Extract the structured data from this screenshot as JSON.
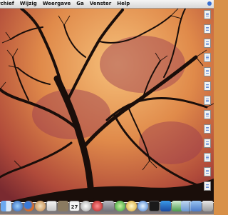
{
  "menubar": {
    "items": [
      "rchief",
      "Wijzig",
      "Weergave",
      "Ga",
      "Venster",
      "Help"
    ]
  },
  "dock": {
    "calendar_date": "27",
    "icons": [
      "finder-icon",
      "dashboard-icon",
      "firefox-icon",
      "camino-icon",
      "preview-icon",
      "gimp-icon",
      "address-book-icon",
      "ical-icon",
      "dvd-player-icon",
      "system-preferences-icon",
      "itunes-icon",
      "adium-icon",
      "safari-icon",
      "terminal-icon",
      "activity-monitor-icon",
      "word-icon",
      "excel-icon",
      "finder-folder-icon",
      "trash-icon"
    ]
  },
  "colors": {
    "menubar_top": "#f4f4f4",
    "menubar_bottom": "#d8d8d8",
    "sky_light": "#f0b060",
    "sky_dark": "#a84830",
    "tree": "#1a0e0a"
  }
}
